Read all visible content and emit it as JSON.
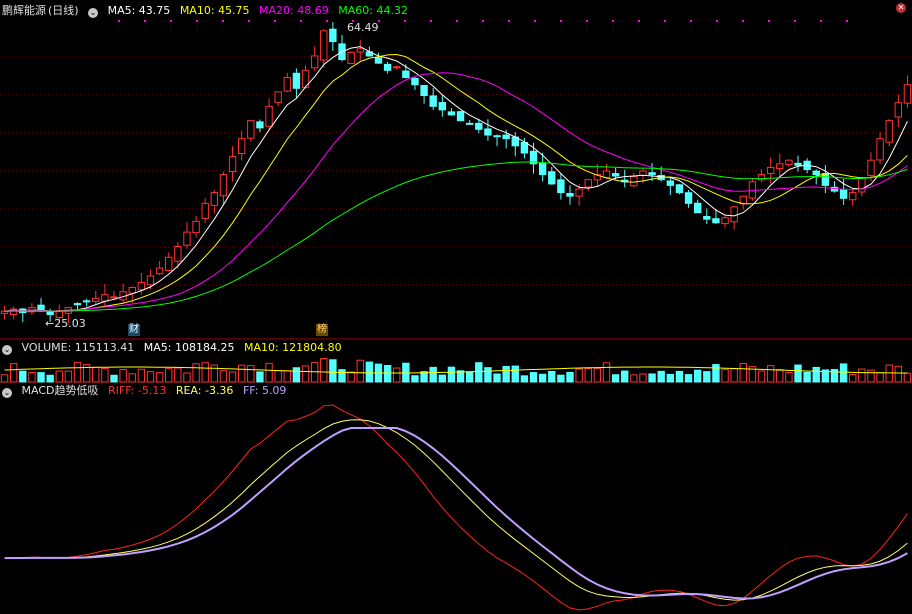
{
  "main": {
    "stock_name": "鹏辉能源",
    "period": "(日线)",
    "ma_items": [
      {
        "label": "MA5: 43.75",
        "color": "#ffffff"
      },
      {
        "label": "MA10: 45.75",
        "color": "#ffff00"
      },
      {
        "label": "MA20: 48.69",
        "color": "#ff00ff"
      },
      {
        "label": "MA60: 44.32",
        "color": "#00ff00"
      }
    ],
    "high_label": "64.49",
    "low_label": "25.03",
    "tag1": "财",
    "tag2": "榜"
  },
  "volume": {
    "title": "VOLUME: 115113.41",
    "ma5": "MA5: 108184.25",
    "ma10": "MA10: 121804.80"
  },
  "macd": {
    "title": "MACD趋势低吸",
    "riff": "RIFF: -5.13",
    "rea": "REA: -3.36",
    "ff": "FF: 5.09"
  },
  "colors": {
    "up": "#ff3232",
    "down": "#54ffff",
    "grid": "#800000",
    "riff": "#ff2020",
    "rea": "#ffff66",
    "ff": "#c0a0ff"
  },
  "chart_data": [
    {
      "type": "candlestick",
      "title": "鹏辉能源 (日线)",
      "price_range": [
        24,
        66
      ],
      "high": 64.49,
      "low": 25.03,
      "close_series": [
        25.5,
        25.8,
        25.3,
        26,
        25.5,
        25.03,
        25.6,
        26,
        26.4,
        26.8,
        27.3,
        27.8,
        27.5,
        28.2,
        28.8,
        29.5,
        30.4,
        31.5,
        33,
        34.5,
        36.5,
        38,
        40.5,
        42,
        44.5,
        47,
        49.5,
        52,
        51,
        54,
        56,
        58,
        56.5,
        59,
        61,
        64.49,
        63,
        60.5,
        61.5,
        62,
        61,
        60,
        59,
        59.5,
        58,
        57,
        55.5,
        54,
        53.5,
        52.8,
        52,
        51.5,
        50.8,
        50,
        49.8,
        49.5,
        48.5,
        47.5,
        46,
        44.5,
        43.2,
        42,
        41.5,
        42.5,
        43.8,
        44.5,
        45,
        44.3,
        43.5,
        44.2,
        45,
        44.5,
        43.8,
        43,
        42,
        40.5,
        39.2,
        38.3,
        37.8,
        38.5,
        40,
        41.5,
        43.5,
        44.5,
        45.5,
        46,
        46.5,
        45.8,
        45.2,
        44.5,
        43,
        42.2,
        41.2,
        42,
        44,
        46.5,
        49.5,
        52,
        54.5,
        57
      ],
      "ma5": 43.75,
      "ma10": 45.75,
      "ma20": 48.69,
      "ma60": 44.32
    },
    {
      "type": "bar",
      "title": "VOLUME",
      "value": 115113.41,
      "ma5": 108184.25,
      "ma10": 121804.8
    },
    {
      "type": "line",
      "title": "MACD趋势低吸",
      "series": [
        {
          "name": "RIFF",
          "value": -5.13
        },
        {
          "name": "REA",
          "value": -3.36
        },
        {
          "name": "FF",
          "value": 5.09
        }
      ]
    }
  ]
}
